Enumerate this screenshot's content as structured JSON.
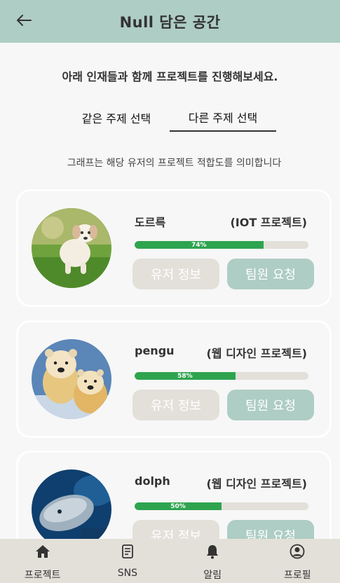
{
  "header": {
    "title": "Null 담은 공간",
    "back_icon": "arrow-left-icon"
  },
  "intro": "아래 인재들과 함께 프로젝트를 진행해보세요.",
  "tabs": [
    {
      "label": "같은 주제 선택",
      "active": false
    },
    {
      "label": "다른 주제 선택",
      "active": true
    }
  ],
  "caption": "그래프는 해당 유저의 프로젝트 적합도를 의미합니다",
  "cards": [
    {
      "name": "도르륵",
      "project": "(IOT 프로젝트)",
      "fit": 74,
      "fit_label": "74%",
      "info_label": "유저 정보",
      "request_label": "팀원 요청"
    },
    {
      "name": "pengu",
      "project": "(웹 디자인 프로젝트)",
      "fit": 58,
      "fit_label": "58%",
      "info_label": "유저 정보",
      "request_label": "팀원 요청"
    },
    {
      "name": "dolph",
      "project": "(웹 디자인 프로젝트)",
      "fit": 50,
      "fit_label": "50%",
      "info_label": "유저 정보",
      "request_label": "팀원 요청"
    }
  ],
  "nav": [
    {
      "label": "프로젝트",
      "icon": "home-icon"
    },
    {
      "label": "SNS",
      "icon": "document-icon"
    },
    {
      "label": "알림",
      "icon": "bell-icon"
    },
    {
      "label": "프로필",
      "icon": "user-circle-icon"
    }
  ],
  "colors": {
    "header": "#aecdc4",
    "progress": "#2ea44f",
    "track": "#e3e0da",
    "info_button": "#e3e0da",
    "request_button": "#aecdc4",
    "nav_background": "#e3e0da"
  }
}
